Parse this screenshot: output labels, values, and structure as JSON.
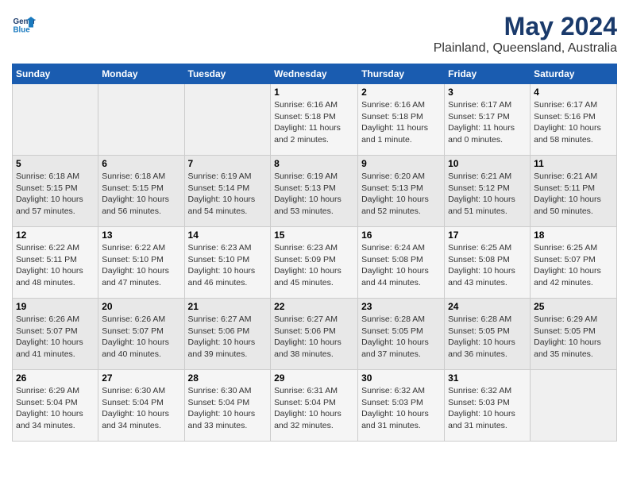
{
  "header": {
    "logo_general": "General",
    "logo_blue": "Blue",
    "title": "May 2024",
    "subtitle": "Plainland, Queensland, Australia"
  },
  "days_of_week": [
    "Sunday",
    "Monday",
    "Tuesday",
    "Wednesday",
    "Thursday",
    "Friday",
    "Saturday"
  ],
  "weeks": [
    [
      {
        "num": "",
        "info": ""
      },
      {
        "num": "",
        "info": ""
      },
      {
        "num": "",
        "info": ""
      },
      {
        "num": "1",
        "info": "Sunrise: 6:16 AM\nSunset: 5:18 PM\nDaylight: 11 hours\nand 2 minutes."
      },
      {
        "num": "2",
        "info": "Sunrise: 6:16 AM\nSunset: 5:18 PM\nDaylight: 11 hours\nand 1 minute."
      },
      {
        "num": "3",
        "info": "Sunrise: 6:17 AM\nSunset: 5:17 PM\nDaylight: 11 hours\nand 0 minutes."
      },
      {
        "num": "4",
        "info": "Sunrise: 6:17 AM\nSunset: 5:16 PM\nDaylight: 10 hours\nand 58 minutes."
      }
    ],
    [
      {
        "num": "5",
        "info": "Sunrise: 6:18 AM\nSunset: 5:15 PM\nDaylight: 10 hours\nand 57 minutes."
      },
      {
        "num": "6",
        "info": "Sunrise: 6:18 AM\nSunset: 5:15 PM\nDaylight: 10 hours\nand 56 minutes."
      },
      {
        "num": "7",
        "info": "Sunrise: 6:19 AM\nSunset: 5:14 PM\nDaylight: 10 hours\nand 54 minutes."
      },
      {
        "num": "8",
        "info": "Sunrise: 6:19 AM\nSunset: 5:13 PM\nDaylight: 10 hours\nand 53 minutes."
      },
      {
        "num": "9",
        "info": "Sunrise: 6:20 AM\nSunset: 5:13 PM\nDaylight: 10 hours\nand 52 minutes."
      },
      {
        "num": "10",
        "info": "Sunrise: 6:21 AM\nSunset: 5:12 PM\nDaylight: 10 hours\nand 51 minutes."
      },
      {
        "num": "11",
        "info": "Sunrise: 6:21 AM\nSunset: 5:11 PM\nDaylight: 10 hours\nand 50 minutes."
      }
    ],
    [
      {
        "num": "12",
        "info": "Sunrise: 6:22 AM\nSunset: 5:11 PM\nDaylight: 10 hours\nand 48 minutes."
      },
      {
        "num": "13",
        "info": "Sunrise: 6:22 AM\nSunset: 5:10 PM\nDaylight: 10 hours\nand 47 minutes."
      },
      {
        "num": "14",
        "info": "Sunrise: 6:23 AM\nSunset: 5:10 PM\nDaylight: 10 hours\nand 46 minutes."
      },
      {
        "num": "15",
        "info": "Sunrise: 6:23 AM\nSunset: 5:09 PM\nDaylight: 10 hours\nand 45 minutes."
      },
      {
        "num": "16",
        "info": "Sunrise: 6:24 AM\nSunset: 5:08 PM\nDaylight: 10 hours\nand 44 minutes."
      },
      {
        "num": "17",
        "info": "Sunrise: 6:25 AM\nSunset: 5:08 PM\nDaylight: 10 hours\nand 43 minutes."
      },
      {
        "num": "18",
        "info": "Sunrise: 6:25 AM\nSunset: 5:07 PM\nDaylight: 10 hours\nand 42 minutes."
      }
    ],
    [
      {
        "num": "19",
        "info": "Sunrise: 6:26 AM\nSunset: 5:07 PM\nDaylight: 10 hours\nand 41 minutes."
      },
      {
        "num": "20",
        "info": "Sunrise: 6:26 AM\nSunset: 5:07 PM\nDaylight: 10 hours\nand 40 minutes."
      },
      {
        "num": "21",
        "info": "Sunrise: 6:27 AM\nSunset: 5:06 PM\nDaylight: 10 hours\nand 39 minutes."
      },
      {
        "num": "22",
        "info": "Sunrise: 6:27 AM\nSunset: 5:06 PM\nDaylight: 10 hours\nand 38 minutes."
      },
      {
        "num": "23",
        "info": "Sunrise: 6:28 AM\nSunset: 5:05 PM\nDaylight: 10 hours\nand 37 minutes."
      },
      {
        "num": "24",
        "info": "Sunrise: 6:28 AM\nSunset: 5:05 PM\nDaylight: 10 hours\nand 36 minutes."
      },
      {
        "num": "25",
        "info": "Sunrise: 6:29 AM\nSunset: 5:05 PM\nDaylight: 10 hours\nand 35 minutes."
      }
    ],
    [
      {
        "num": "26",
        "info": "Sunrise: 6:29 AM\nSunset: 5:04 PM\nDaylight: 10 hours\nand 34 minutes."
      },
      {
        "num": "27",
        "info": "Sunrise: 6:30 AM\nSunset: 5:04 PM\nDaylight: 10 hours\nand 34 minutes."
      },
      {
        "num": "28",
        "info": "Sunrise: 6:30 AM\nSunset: 5:04 PM\nDaylight: 10 hours\nand 33 minutes."
      },
      {
        "num": "29",
        "info": "Sunrise: 6:31 AM\nSunset: 5:04 PM\nDaylight: 10 hours\nand 32 minutes."
      },
      {
        "num": "30",
        "info": "Sunrise: 6:32 AM\nSunset: 5:03 PM\nDaylight: 10 hours\nand 31 minutes."
      },
      {
        "num": "31",
        "info": "Sunrise: 6:32 AM\nSunset: 5:03 PM\nDaylight: 10 hours\nand 31 minutes."
      },
      {
        "num": "",
        "info": ""
      }
    ]
  ]
}
